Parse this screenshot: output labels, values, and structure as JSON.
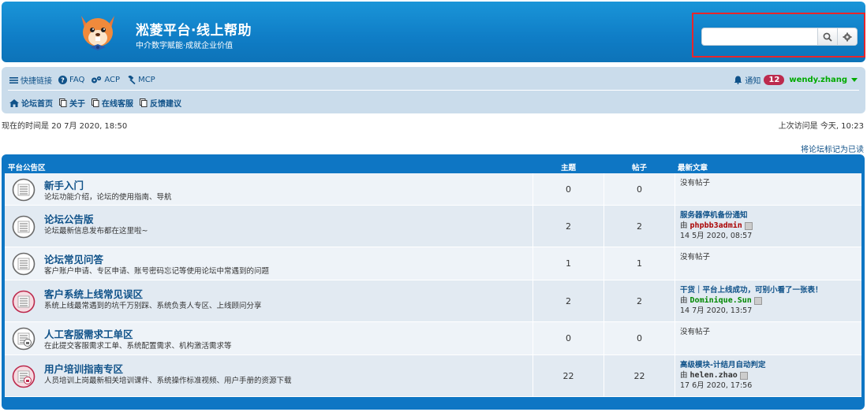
{
  "header": {
    "title": "淞菱平台·线上帮助",
    "description": "中介数字赋能·成就企业价值",
    "search": {
      "value": "",
      "placeholder": ""
    }
  },
  "nav": {
    "quick_links": "快捷链接",
    "faq": "FAQ",
    "acp": "ACP",
    "mcp": "MCP",
    "notifications_label": "通知",
    "notifications_count": "12",
    "username": "wendy.zhang",
    "crumbs": [
      "论坛首页",
      "关于",
      "在线客服",
      "反馈建议"
    ]
  },
  "status": {
    "current_time": "现在的时间是 20 7月 2020, 18:50",
    "last_visit": "上次访问是 今天, 10:23",
    "mark_read": "将论坛标记为已读"
  },
  "forum_table": {
    "category": "平台公告区",
    "col_topics": "主题",
    "col_posts": "帖子",
    "col_last": "最新文章",
    "rows": [
      {
        "title": "新手入门",
        "desc": "论坛功能介绍，论坛的使用指南、导航",
        "topics": "0",
        "posts": "0",
        "last_title": "没有帖子",
        "last_by": "",
        "last_user": "",
        "last_time": "",
        "icon": "forum-read-icon"
      },
      {
        "title": "论坛公告版",
        "desc": "论坛最新信息发布都在这里啦~",
        "topics": "2",
        "posts": "2",
        "last_title": "服务器停机备份通知",
        "last_by": "由",
        "last_user": "phpbb3admin",
        "last_time": "14 5月 2020, 08:57",
        "icon": "forum-read-icon"
      },
      {
        "title": "论坛常见问答",
        "desc": "客户账户申请、专区申请、账号密码忘记等使用论坛中常遇到的问题",
        "topics": "1",
        "posts": "1",
        "last_title": "没有帖子",
        "last_by": "",
        "last_user": "",
        "last_time": "",
        "icon": "forum-read-icon"
      },
      {
        "title": "客户系统上线常见误区",
        "desc": "系统上线最常遇到的坑千万别踩、系统负责人专区、上线顾问分享",
        "topics": "2",
        "posts": "2",
        "last_title": "干货｜平台上线成功，可别小看了一张表！",
        "last_by": "由",
        "last_user": "Dominique.Sun",
        "last_time": "14 7月 2020, 13:57",
        "icon": "forum-unread-icon"
      },
      {
        "title": "人工客服需求工单区",
        "desc": "在此提交客服需求工单、系统配置需求、机构激活需求等",
        "topics": "0",
        "posts": "0",
        "last_title": "没有帖子",
        "last_by": "",
        "last_user": "",
        "last_time": "",
        "icon": "forum-locked-icon"
      },
      {
        "title": "用户培训指南专区",
        "desc": "人员培训上岗最新相关培训课件、系统操作标准视频、用户手册的资源下载",
        "topics": "22",
        "posts": "22",
        "last_title": "高级模块-计结月自动判定",
        "last_by": "由",
        "last_user": "helen.zhao",
        "last_time": "17 6月 2020, 17:56",
        "icon": "forum-unread-locked-icon"
      }
    ]
  },
  "colors": {
    "header_blue": "#0f7dc6",
    "link_blue": "#105289",
    "admin_red": "#aa0000",
    "mod_green": "#00aa00",
    "unread_red": "#bc2a4d"
  }
}
